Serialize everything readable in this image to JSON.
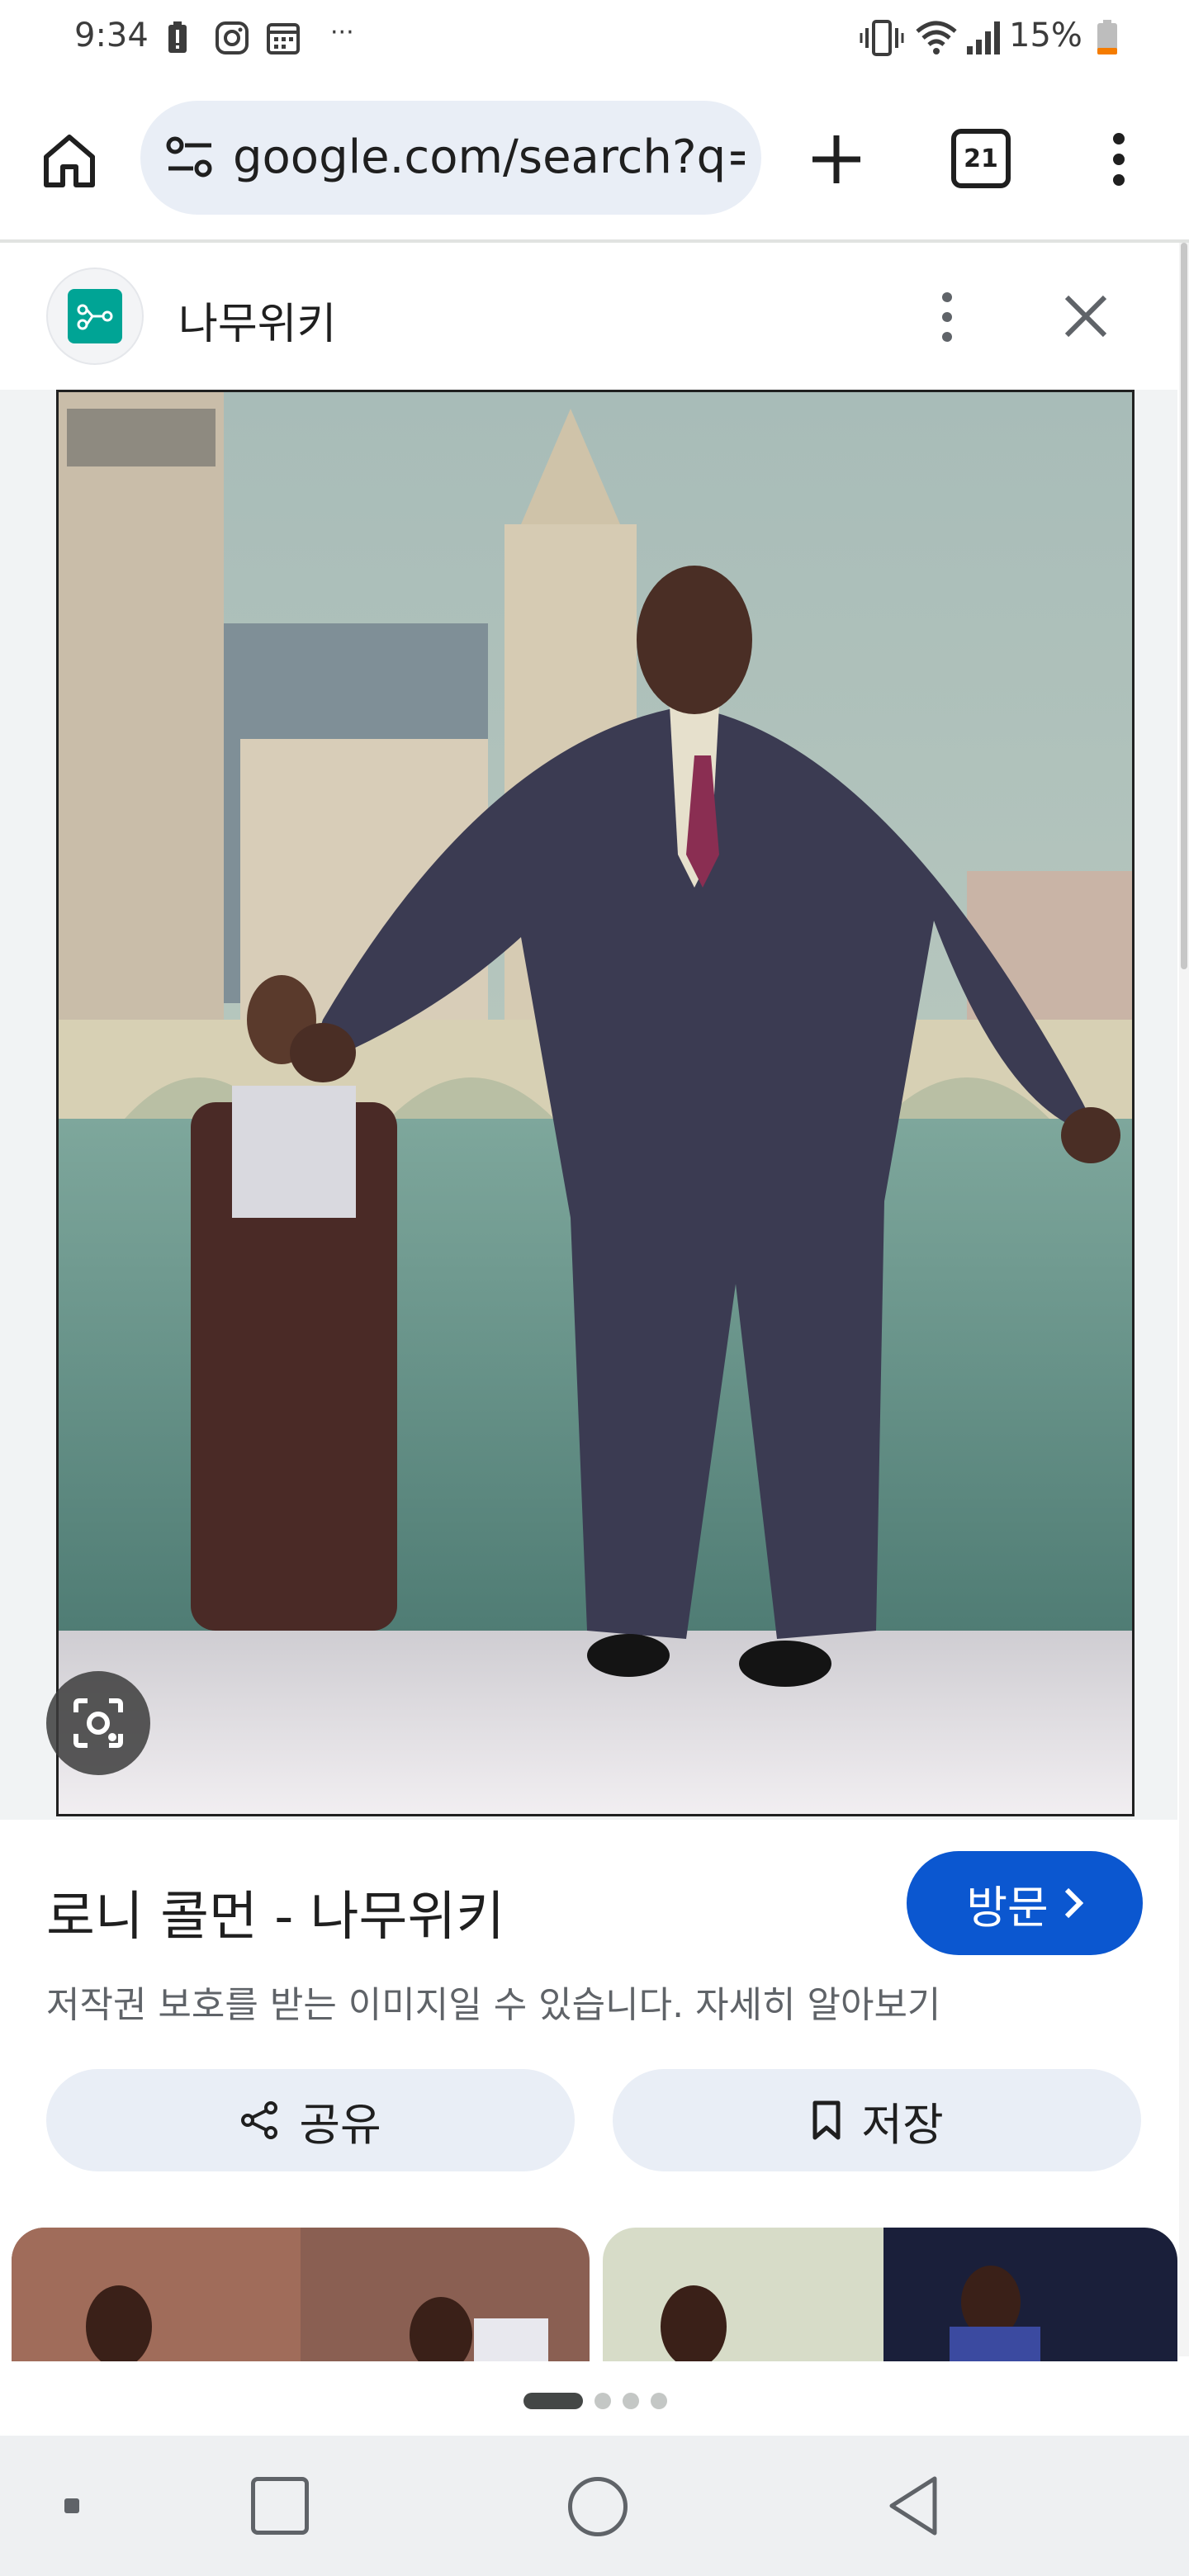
{
  "status_bar": {
    "time": "9:34",
    "battery": "15%",
    "notification_more": "···",
    "left_icons": [
      "battery-alert-icon",
      "instagram-icon",
      "calendar-icon"
    ],
    "right_icons": [
      "vibrate-icon",
      "wifi-icon",
      "signal-icon",
      "battery-icon"
    ],
    "battery_color": "#f57c00"
  },
  "browser": {
    "url": "google.com/search?q=",
    "tab_count": "21",
    "icons": [
      "home-icon",
      "site-settings-icon",
      "new-tab-icon",
      "tab-switcher-icon",
      "more-vert-icon"
    ]
  },
  "source": {
    "name": "나무위키",
    "logo_color": "#00a495",
    "icons": [
      "namuwiki-logo-icon",
      "more-vert-icon",
      "close-icon"
    ]
  },
  "result": {
    "title": "로니 콜먼 - 나무위키",
    "visit_label": "방문",
    "copyright_note": "저작권 보호를 받는 이미지일 수 있습니다. 자세히 알아보기",
    "share_label": "공유",
    "save_label": "저장",
    "accent_color": "#0b57d0"
  },
  "carousel": {
    "page_count": 4,
    "active_page": 1
  },
  "nav_bar": {
    "icons": [
      "recent-apps-dot-icon",
      "overview-icon",
      "home-circle-icon",
      "back-icon"
    ]
  }
}
